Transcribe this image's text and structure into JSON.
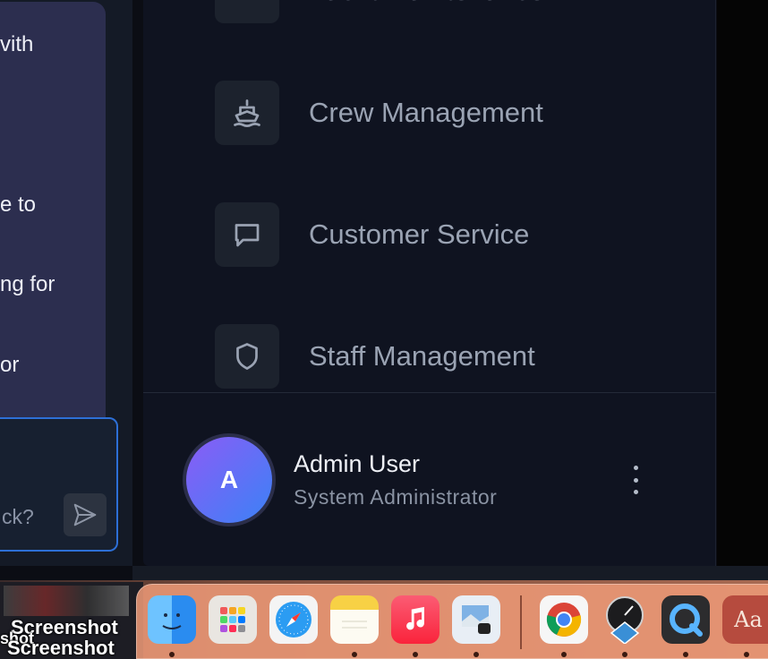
{
  "chat": {
    "lines": [
      "vith",
      "e to",
      "ng for",
      "or"
    ],
    "input_placeholder": "ck?"
  },
  "menu": {
    "partial_label": "Yacht Maintenance",
    "items": [
      {
        "label": "Crew Management",
        "icon": "ship-icon"
      },
      {
        "label": "Customer Service",
        "icon": "message-square-icon"
      },
      {
        "label": "Staff Management",
        "icon": "shield-icon"
      }
    ]
  },
  "user": {
    "initial": "A",
    "name": "Admin User",
    "role": "System Administrator"
  },
  "desktop": {
    "screenshot_label_1": "Screenshot",
    "screenshot_label_2": "shot",
    "screenshot_label_3": "Screenshot"
  },
  "dock": {
    "apps": [
      "Finder",
      "Launchpad",
      "Safari",
      "Notes",
      "Music",
      "Preview",
      "Google Chrome",
      "Instruments",
      "QuickTime Player",
      "Dictionary"
    ],
    "dictionary_glyph": "Aa"
  }
}
